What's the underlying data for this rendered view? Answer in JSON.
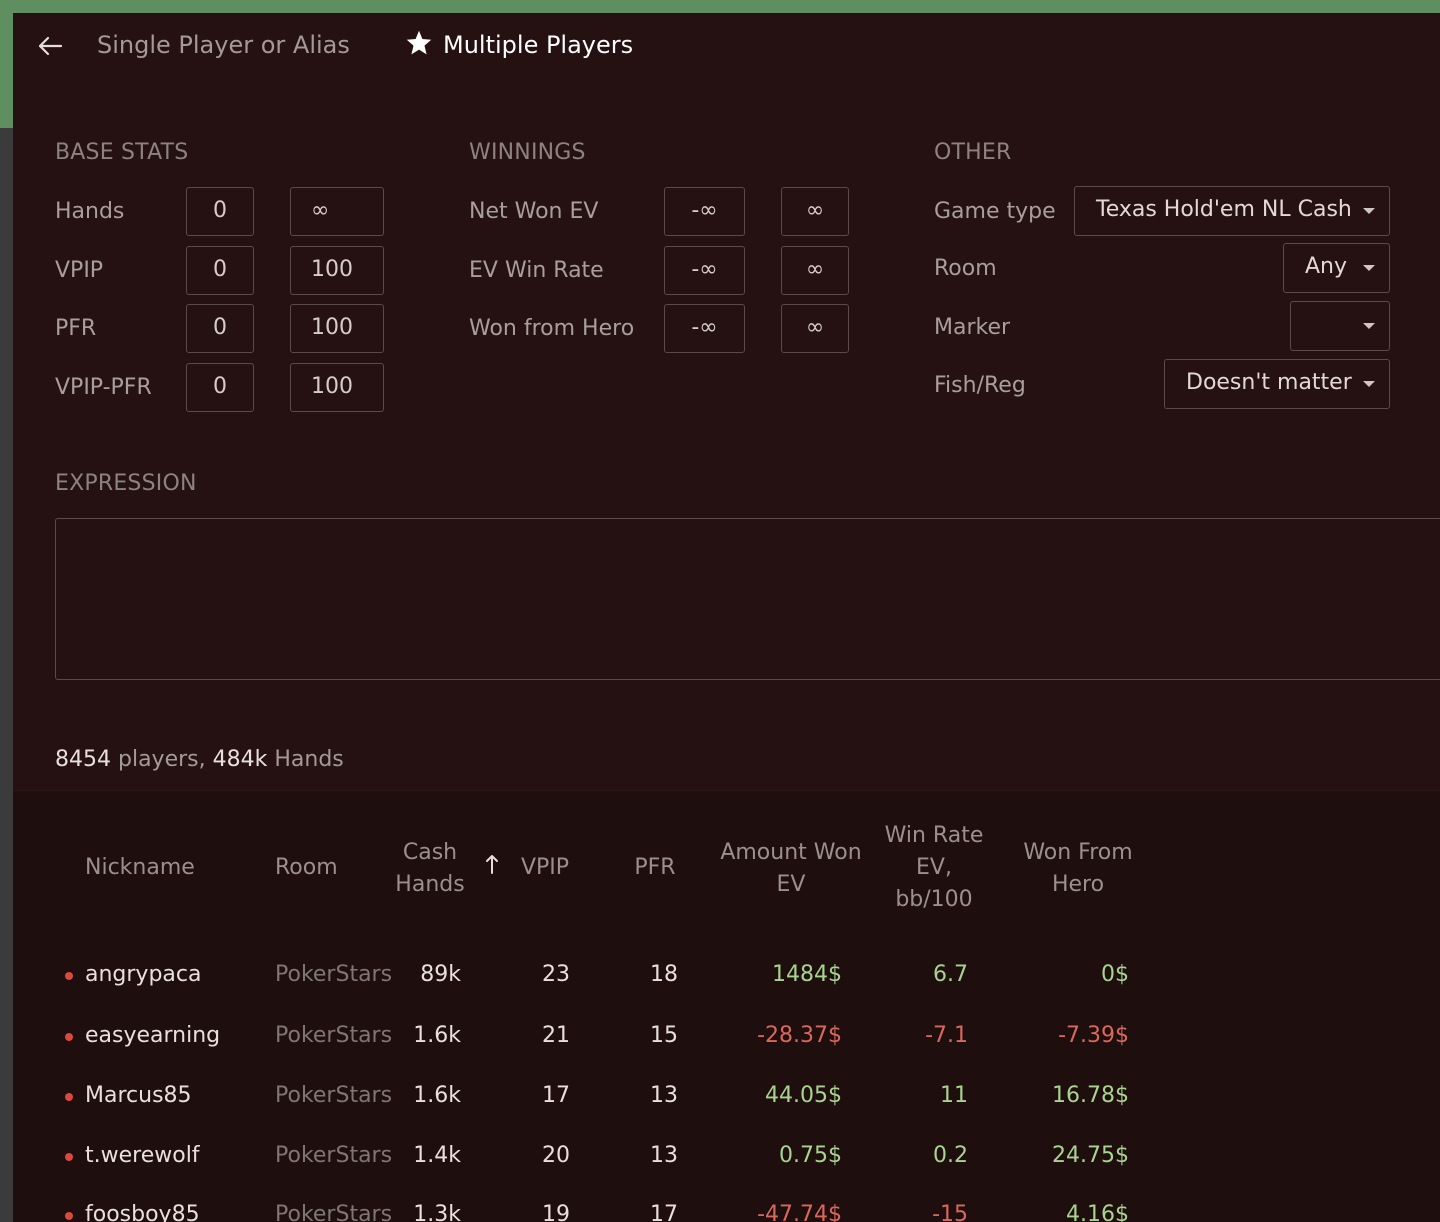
{
  "header": {
    "back_icon": "arrow-left-icon",
    "tab_single": "Single Player or Alias",
    "tab_multi": "Multiple Players",
    "star_icon": "star-icon"
  },
  "base_stats": {
    "title": "BASE STATS",
    "rows": [
      {
        "label": "Hands",
        "min": "0",
        "max": "∞"
      },
      {
        "label": "VPIP",
        "min": "0",
        "max": "100"
      },
      {
        "label": "PFR",
        "min": "0",
        "max": "100"
      },
      {
        "label": "VPIP-PFR",
        "min": "0",
        "max": "100"
      }
    ]
  },
  "winnings": {
    "title": "WINNINGS",
    "rows": [
      {
        "label": "Net Won EV",
        "min": "-∞",
        "max": "∞"
      },
      {
        "label": "EV Win Rate",
        "min": "-∞",
        "max": "∞"
      },
      {
        "label": "Won from Hero",
        "min": "-∞",
        "max": "∞"
      }
    ]
  },
  "other": {
    "title": "OTHER",
    "game_type_label": "Game type",
    "game_type_value": "Texas Hold'em NL Cash",
    "room_label": "Room",
    "room_value": "Any",
    "marker_label": "Marker",
    "marker_value": "",
    "fish_reg_label": "Fish/Reg",
    "fish_reg_value": "Doesn't matter"
  },
  "expression": {
    "title": "EXPRESSION",
    "value": ""
  },
  "summary": {
    "players_count": "8454",
    "players_label": "players,",
    "hands_count": "484k",
    "hands_label": "Hands"
  },
  "table": {
    "columns": {
      "nickname": "Nickname",
      "room": "Room",
      "cash_hands_1": "Cash",
      "cash_hands_2": "Hands",
      "vpip": "VPIP",
      "pfr": "PFR",
      "amount_won_1": "Amount Won",
      "amount_won_2": "EV",
      "win_rate_1": "Win Rate",
      "win_rate_2": "EV,",
      "win_rate_3": "bb/100",
      "won_from_hero_1": "Won From",
      "won_from_hero_2": "Hero"
    },
    "sort_icon": "arrow-up-icon",
    "rows": [
      {
        "nickname": "angrypaca",
        "room": "PokerStars",
        "hands": "89k",
        "vpip": "23",
        "pfr": "18",
        "amount": "1484$",
        "winrate": "6.7",
        "hero": "0$",
        "amount_sign": "pos",
        "winrate_sign": "pos",
        "hero_sign": "pos"
      },
      {
        "nickname": "easyearning",
        "room": "PokerStars",
        "hands": "1.6k",
        "vpip": "21",
        "pfr": "15",
        "amount": "-28.37$",
        "winrate": "-7.1",
        "hero": "-7.39$",
        "amount_sign": "neg",
        "winrate_sign": "neg",
        "hero_sign": "neg"
      },
      {
        "nickname": "Marcus85",
        "room": "PokerStars",
        "hands": "1.6k",
        "vpip": "17",
        "pfr": "13",
        "amount": "44.05$",
        "winrate": "11",
        "hero": "16.78$",
        "amount_sign": "pos",
        "winrate_sign": "pos",
        "hero_sign": "pos"
      },
      {
        "nickname": "t.werewolf",
        "room": "PokerStars",
        "hands": "1.4k",
        "vpip": "20",
        "pfr": "13",
        "amount": "0.75$",
        "winrate": "0.2",
        "hero": "24.75$",
        "amount_sign": "pos",
        "winrate_sign": "pos",
        "hero_sign": "pos"
      },
      {
        "nickname": "foosboy85",
        "room": "PokerStars",
        "hands": "1.3k",
        "vpip": "19",
        "pfr": "17",
        "amount": "-47.74$",
        "winrate": "-15",
        "hero": "4.16$",
        "amount_sign": "neg",
        "winrate_sign": "neg",
        "hero_sign": "pos"
      }
    ]
  },
  "colors": {
    "background": "#251111",
    "positive": "#a8d48f",
    "negative": "#d9685c",
    "status_dot": "#d9493e",
    "window_frame": "#5f8f60"
  }
}
